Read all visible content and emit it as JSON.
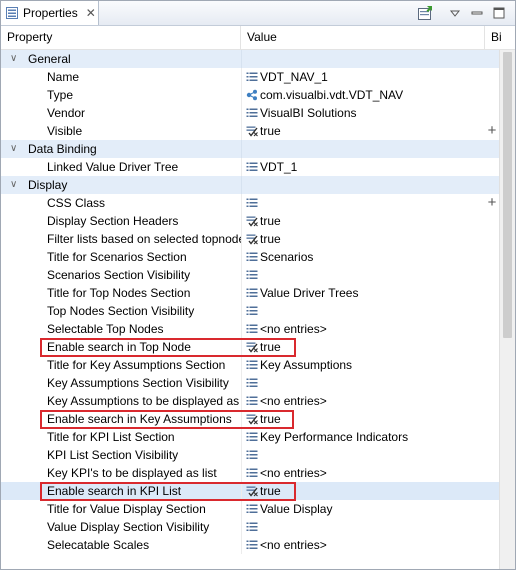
{
  "view": {
    "tab_title": "Properties",
    "tab_close": "✕",
    "toolbar": [
      "pin-view-icon",
      "view-menu-icon",
      "minimize-icon",
      "maximize-icon"
    ]
  },
  "columns": [
    "Property",
    "Value",
    "Bi"
  ],
  "categories": {
    "general": "General",
    "data_binding": "Data Binding",
    "display": "Display"
  },
  "rows": [
    {
      "prop": "Name",
      "value": "VDT_NAV_1",
      "icon": "list-icon"
    },
    {
      "prop": "Type",
      "value": "com.visualbi.vdt.VDT_NAV",
      "icon": "component-icon"
    },
    {
      "prop": "Vendor",
      "value": "VisualBI Solutions",
      "icon": "list-icon"
    },
    {
      "prop": "Visible",
      "value": "true",
      "icon": "boolean-icon",
      "plus": "+"
    },
    {
      "prop": "Linked Value Driver Tree",
      "value": "VDT_1",
      "icon": "list-icon"
    },
    {
      "prop": "CSS Class",
      "value": "",
      "icon": "list-icon",
      "plus": "+"
    },
    {
      "prop": "Display Section Headers",
      "value": "true",
      "icon": "boolean-icon"
    },
    {
      "prop": "Filter lists based on selected topnode",
      "value": "true",
      "icon": "boolean-icon"
    },
    {
      "prop": "Title for Scenarios Section",
      "value": "Scenarios",
      "icon": "list-icon"
    },
    {
      "prop": "Scenarios Section Visibility",
      "value": "",
      "icon": "list-icon"
    },
    {
      "prop": "Title for Top Nodes Section",
      "value": "Value Driver Trees",
      "icon": "list-icon"
    },
    {
      "prop": "Top Nodes Section Visibility",
      "value": "",
      "icon": "list-icon"
    },
    {
      "prop": "Selectable Top Nodes",
      "value": "<no entries>",
      "icon": "list-icon"
    },
    {
      "prop": "Enable search in Top Node",
      "value": "true",
      "icon": "boolean-icon"
    },
    {
      "prop": "Title for Key Assumptions Section",
      "value": "Key Assumptions",
      "icon": "list-icon"
    },
    {
      "prop": "Key Assumptions Section Visibility",
      "value": "",
      "icon": "list-icon"
    },
    {
      "prop": "Key Assumptions to be displayed as list",
      "value": "<no entries>",
      "icon": "list-icon"
    },
    {
      "prop": "Enable search in Key Assumptions",
      "value": "true",
      "icon": "boolean-icon"
    },
    {
      "prop": "Title for KPI List Section",
      "value": "Key Performance Indicators",
      "icon": "list-icon"
    },
    {
      "prop": "KPI List Section Visibility",
      "value": "",
      "icon": "list-icon"
    },
    {
      "prop": "Key KPI's to be displayed as list",
      "value": "<no entries>",
      "icon": "list-icon"
    },
    {
      "prop": "Enable search in KPI List",
      "value": "true",
      "icon": "boolean-icon"
    },
    {
      "prop": "Title for Value Display Section",
      "value": "Value Display",
      "icon": "list-icon"
    },
    {
      "prop": "Value Display Section Visibility",
      "value": "",
      "icon": "list-icon"
    },
    {
      "prop": "Selecatable Scales",
      "value": "<no entries>",
      "icon": "list-icon"
    }
  ],
  "colors": {
    "highlight_box": "#d9292e",
    "category_bg": "#e3edf9",
    "selected_bg": "#dce9f8"
  }
}
